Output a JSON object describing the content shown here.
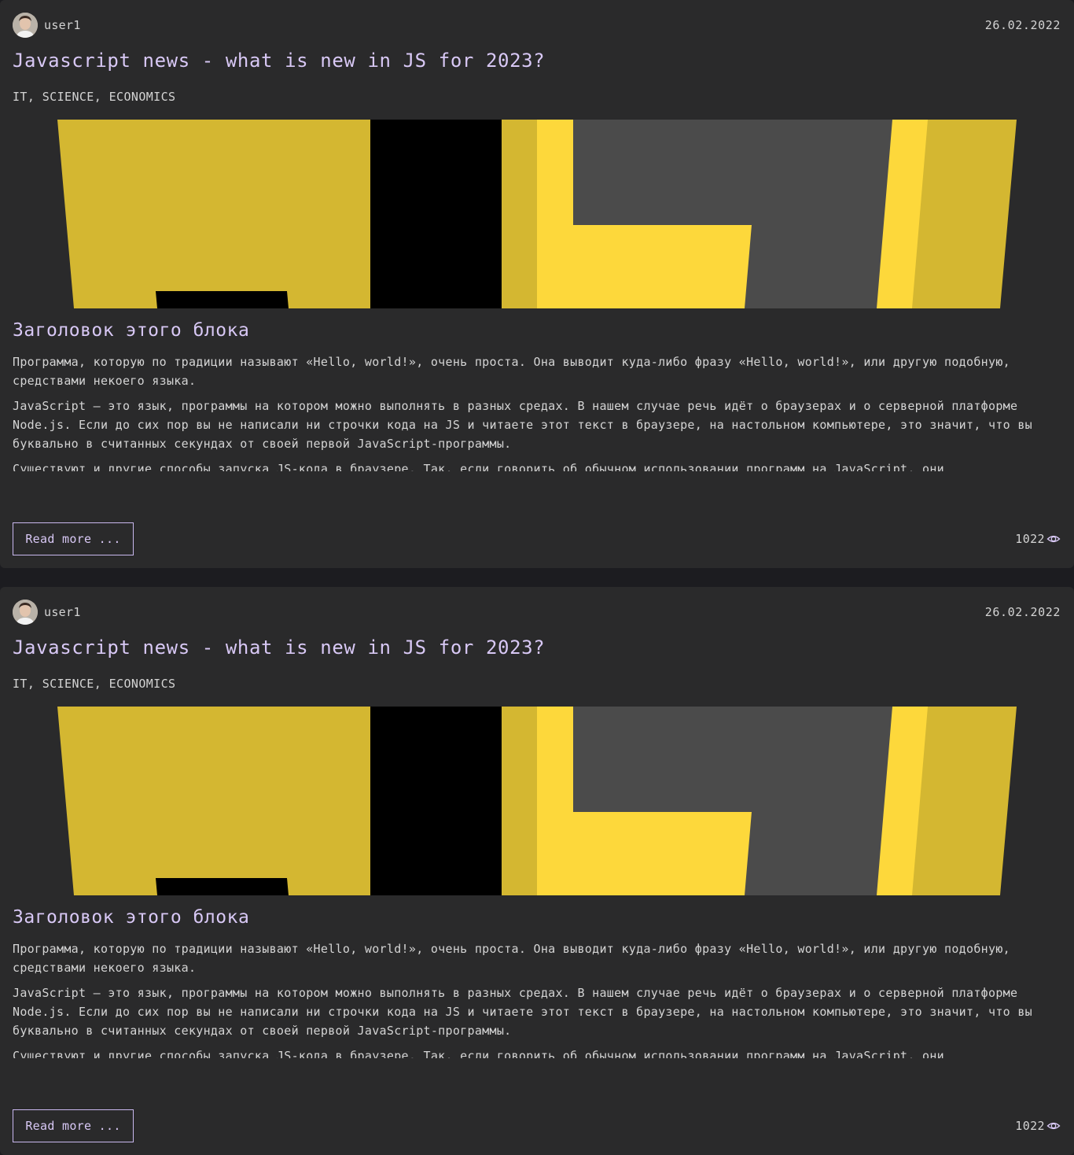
{
  "posts": [
    {
      "author": "user1",
      "date": "26.02.2022",
      "title": "Javascript news - what is new in JS for 2023?",
      "tags": "IT, SCIENCE, ECONOMICS",
      "image_icon": "js-logo-cover",
      "block_title": "Заголовок этого блока",
      "paragraphs": [
        "Программа, которую по традиции называют «Hello, world!», очень проста. Она выводит куда-либо фразу «Hello, world!», или другую подобную, средствами некоего языка.",
        "JavaScript — это язык, программы на котором можно выполнять в разных средах. В нашем случае речь идёт о браузерах и о серверной платформе Node.js. Если до сих пор вы не написали ни строчки кода на JS и читаете этот текст в браузере, на настольном компьютере, это значит, что вы буквально в считанных секундах от своей первой JavaScript-программы.",
        "Существуют и другие способы запуска JS-кода в браузере. Так, если говорить об обычном использовании программ на JavaScript, они"
      ],
      "read_more_label": "Read more ...",
      "views": "1022",
      "views_icon": "eye-icon"
    },
    {
      "author": "user1",
      "date": "26.02.2022",
      "title": "Javascript news - what is new in JS for 2023?",
      "tags": "IT, SCIENCE, ECONOMICS",
      "image_icon": "js-logo-cover",
      "block_title": "Заголовок этого блока",
      "paragraphs": [
        "Программа, которую по традиции называют «Hello, world!», очень проста. Она выводит куда-либо фразу «Hello, world!», или другую подобную, средствами некоего языка.",
        "JavaScript — это язык, программы на котором можно выполнять в разных средах. В нашем случае речь идёт о браузерах и о серверной платформе Node.js. Если до сих пор вы не написали ни строчки кода на JS и читаете этот текст в браузере, на настольном компьютере, это значит, что вы буквально в считанных секундах от своей первой JavaScript-программы.",
        "Существуют и другие способы запуска JS-кода в браузере. Так, если говорить об обычном использовании программ на JavaScript, они"
      ],
      "read_more_label": "Read more ...",
      "views": "1022",
      "views_icon": "eye-icon"
    }
  ],
  "colors": {
    "page_background": "#1c1c20",
    "card_background": "#2a2a2b",
    "accent_text": "#d8c8f5",
    "body_text": "#d4d4d4",
    "button_border": "#c9b8ef",
    "js_yellow_dark": "#d4b731",
    "js_yellow_light": "#fdd83b",
    "js_gray": "#4b4b4b"
  }
}
